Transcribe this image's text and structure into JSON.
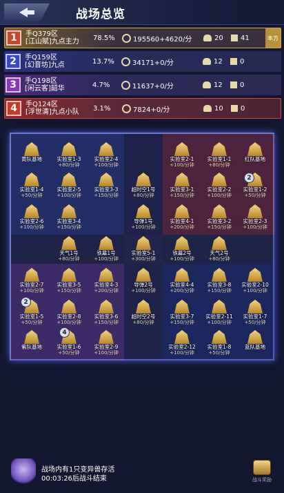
{
  "header": {
    "title": "战场总览",
    "back_icon": "arrow-back-icon"
  },
  "rankings": [
    {
      "rank": "1",
      "server": "手Q379区",
      "guild": "[江山赋]九点主力",
      "percent": "78.5%",
      "score": "195560+4620/分",
      "players": "20",
      "bases": "41",
      "side_tag": "本方"
    },
    {
      "rank": "2",
      "server": "手Q159区",
      "guild": "[幻音坊]九点",
      "percent": "13.7%",
      "score": "34171+0/分",
      "players": "12",
      "bases": "0"
    },
    {
      "rank": "3",
      "server": "手Q198区",
      "guild": "[闲云客]韶华",
      "percent": "4.7%",
      "score": "11637+0/分",
      "players": "12",
      "bases": "0"
    },
    {
      "rank": "4",
      "server": "手Q124区",
      "guild": "[浮世清]九点小队",
      "percent": "3.1%",
      "score": "7824+0/分",
      "players": "10",
      "bases": "0"
    }
  ],
  "map": {
    "cells": [
      {
        "label": "黄队基地",
        "rate": ""
      },
      {
        "label": "实验室1-3",
        "rate": "+80/分钟"
      },
      {
        "label": "实验室2-4",
        "rate": "+100/分钟"
      },
      {
        "label": "实验室2-1",
        "rate": "+100/分钟"
      },
      {
        "label": "实验室1-1",
        "rate": "+80/分钟"
      },
      {
        "label": "红队基地",
        "rate": ""
      },
      {
        "label": "实验室1-4",
        "rate": "+50/分钟"
      },
      {
        "label": "实验室2-5",
        "rate": "+100/分钟"
      },
      {
        "label": "实验室3-3",
        "rate": "+150/分钟"
      },
      {
        "label": "超时空1号",
        "rate": "+80/分钟"
      },
      {
        "label": "实验室3-1",
        "rate": "+150/分钟"
      },
      {
        "label": "实验室2-2",
        "rate": "+100/分钟"
      },
      {
        "label": "实验室1-2",
        "rate": "+50/分钟"
      },
      {
        "label": "实验室2-6",
        "rate": "+100/分钟"
      },
      {
        "label": "实验室3-4",
        "rate": "+150/分钟"
      },
      {
        "label": "导弹1号",
        "rate": "+100/分钟"
      },
      {
        "label": "实验室4-1",
        "rate": "+200/分钟"
      },
      {
        "label": "实验室3-2",
        "rate": "+150/分钟"
      },
      {
        "label": "实验室2-3",
        "rate": "+100/分钟"
      },
      {
        "label": "天气1号",
        "rate": "+80/分钟"
      },
      {
        "label": "铁幕1号",
        "rate": "+100/分钟"
      },
      {
        "label": "实验室5-1",
        "rate": "+300/分钟"
      },
      {
        "label": "铁幕2号",
        "rate": "+100/分钟"
      },
      {
        "label": "天气2号",
        "rate": "+80/分钟"
      },
      {
        "label": "实验室2-7",
        "rate": "+100/分钟"
      },
      {
        "label": "实验室3-5",
        "rate": "+150/分钟"
      },
      {
        "label": "实验室4-3",
        "rate": "+200/分钟"
      },
      {
        "label": "导弹2号",
        "rate": "+100/分钟"
      },
      {
        "label": "实验室4-4",
        "rate": "+200/分钟"
      },
      {
        "label": "实验室3-8",
        "rate": "+150/分钟"
      },
      {
        "label": "实验室2-10",
        "rate": "+100/分钟"
      },
      {
        "label": "实验室1-5",
        "rate": "+50/分钟"
      },
      {
        "label": "实验室2-8",
        "rate": "+100/分钟"
      },
      {
        "label": "实验室3-6",
        "rate": "+150/分钟"
      },
      {
        "label": "超时空2号",
        "rate": "+80/分钟"
      },
      {
        "label": "实验室3-7",
        "rate": "+150/分钟"
      },
      {
        "label": "实验室2-11",
        "rate": "+100/分钟"
      },
      {
        "label": "实验室1-7",
        "rate": "+50/分钟"
      },
      {
        "label": "紫队基地",
        "rate": ""
      },
      {
        "label": "实验室1-6",
        "rate": "+50/分钟"
      },
      {
        "label": "实验室2-9",
        "rate": "+100/分钟"
      },
      {
        "label": "实验室2-12",
        "rate": "+100/分钟"
      },
      {
        "label": "实验室1-8",
        "rate": "+50/分钟"
      },
      {
        "label": "蓝队基地",
        "rate": ""
      }
    ],
    "bubbles": [
      "2",
      "2",
      "4"
    ]
  },
  "footer": {
    "message_line1": "战场内有1只变异兽存活",
    "message_line2": "00:03:26后战斗结束",
    "reward_label": "战斗奖励"
  }
}
